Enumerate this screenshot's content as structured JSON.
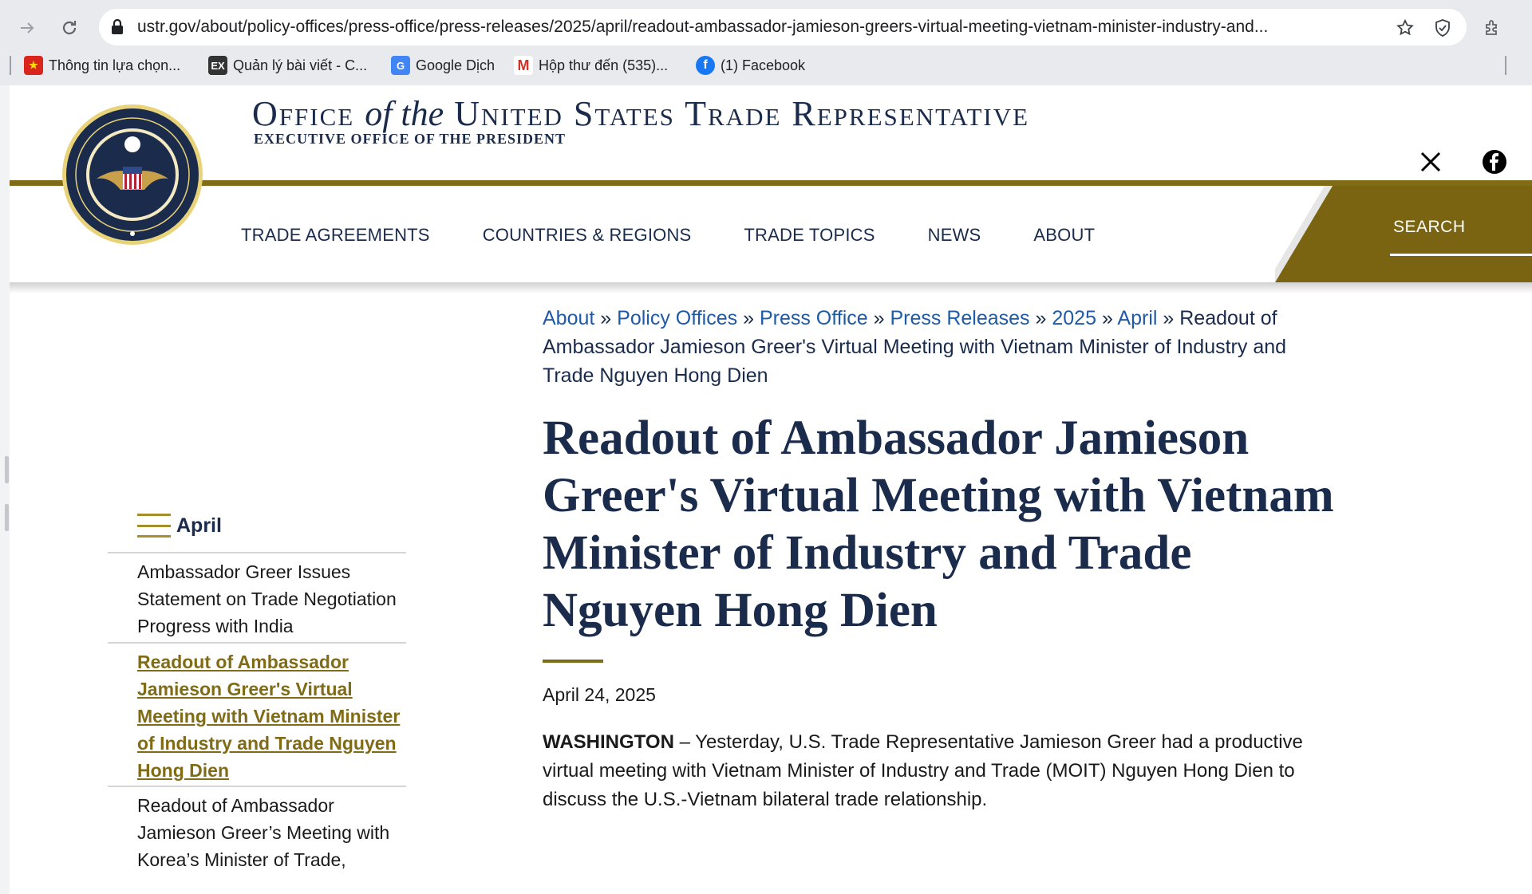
{
  "browser": {
    "url": "ustr.gov/about/policy-offices/press-office/press-releases/2025/april/readout-ambassador-jamieson-greers-virtual-meeting-vietnam-minister-industry-and...",
    "bookmarks": [
      {
        "label": "Thông tin lựa chọn...",
        "icon": "vietnam-flag-icon"
      },
      {
        "label": "Quản lý bài viết - C...",
        "icon": "ex-icon"
      },
      {
        "label": "Google Dịch",
        "icon": "google-translate-icon"
      },
      {
        "label": "Hộp thư đến (535)...",
        "icon": "gmail-icon"
      },
      {
        "label": "(1) Facebook",
        "icon": "facebook-icon"
      }
    ]
  },
  "site": {
    "title_office": "Office",
    "title_of_the": "of the",
    "title_rest": "United States Trade Representative",
    "subtitle": "EXECUTIVE OFFICE OF THE PRESIDENT",
    "nav": [
      "TRADE AGREEMENTS",
      "COUNTRIES & REGIONS",
      "TRADE TOPICS",
      "NEWS",
      "ABOUT"
    ],
    "search_label": "SEARCH",
    "colors": {
      "navy": "#1a2b4b",
      "gold": "#806b17",
      "link": "#1f5aa6"
    }
  },
  "breadcrumb": {
    "items": [
      "About",
      "Policy Offices",
      "Press Office",
      "Press Releases",
      "2025",
      "April"
    ],
    "separator": "»",
    "current": "Readout of Ambassador Jamieson Greer's Virtual Meeting with Vietnam Minister of Industry and Trade Nguyen Hong Dien"
  },
  "sidebar": {
    "title": "April",
    "items": [
      {
        "label": "Ambassador Greer Issues Statement on Trade Negotiation Progress with India",
        "active": false
      },
      {
        "label": "Readout of Ambassador Jamieson Greer's Virtual Meeting with Vietnam Minister of Industry and Trade Nguyen Hong Dien",
        "active": true
      },
      {
        "label": "Readout of Ambassador Jamieson Greer’s Meeting with Korea’s Minister of Trade,",
        "active": false
      }
    ]
  },
  "article": {
    "title": "Readout of Ambassador Jamieson Greer's Virtual Meeting with Vietnam Minister of Industry and Trade Nguyen Hong Dien",
    "date": "April 24, 2025",
    "dateline": "WASHINGTON",
    "lead": " – Yesterday, U.S. Trade Representative Jamieson Greer had a productive virtual meeting with Vietnam Minister of Industry and Trade (MOIT) Nguyen Hong Dien to discuss the U.S.-Vietnam bilateral trade relationship."
  }
}
